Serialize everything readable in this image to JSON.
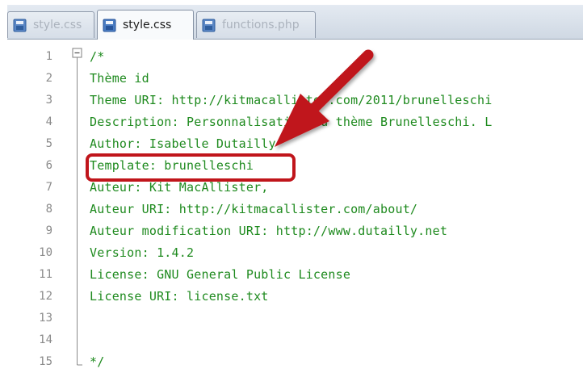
{
  "tabs": [
    {
      "label": "style.css",
      "active": false
    },
    {
      "label": "style.css",
      "active": true
    },
    {
      "label": "functions.php",
      "active": false
    }
  ],
  "editor": {
    "lines": [
      {
        "num": "1",
        "text": "/*"
      },
      {
        "num": "2",
        "text": "Thème id"
      },
      {
        "num": "3",
        "text": "Theme URI: http://kitmacallister.com/2011/brunelleschi"
      },
      {
        "num": "4",
        "text": "Description: Personnalisation du thème Brunelleschi. L"
      },
      {
        "num": "5",
        "text": "Author: Isabelle Dutailly"
      },
      {
        "num": "6",
        "text": "Template: brunelleschi"
      },
      {
        "num": "7",
        "text": "Auteur: Kit MacAllister,"
      },
      {
        "num": "8",
        "text": "Auteur URI: http://kitmacallister.com/about/"
      },
      {
        "num": "9",
        "text": "Auteur modification URI: http://www.dutailly.net"
      },
      {
        "num": "10",
        "text": "Version: 1.4.2"
      },
      {
        "num": "11",
        "text": "License: GNU General Public License"
      },
      {
        "num": "12",
        "text": "License URI: license.txt"
      },
      {
        "num": "13",
        "text": ""
      },
      {
        "num": "14",
        "text": ""
      },
      {
        "num": "15",
        "text": "*/"
      }
    ]
  },
  "annotation": {
    "highlighted_line": "6",
    "color": "#c0151b"
  },
  "colors": {
    "code_text": "#1e8a1e",
    "line_number": "#8b8b8b",
    "tab_bar": "#dde4ed"
  },
  "icons": {
    "file": "file-icon",
    "fold": "fold-minus-icon",
    "arrow": "red-arrow-annotation"
  }
}
